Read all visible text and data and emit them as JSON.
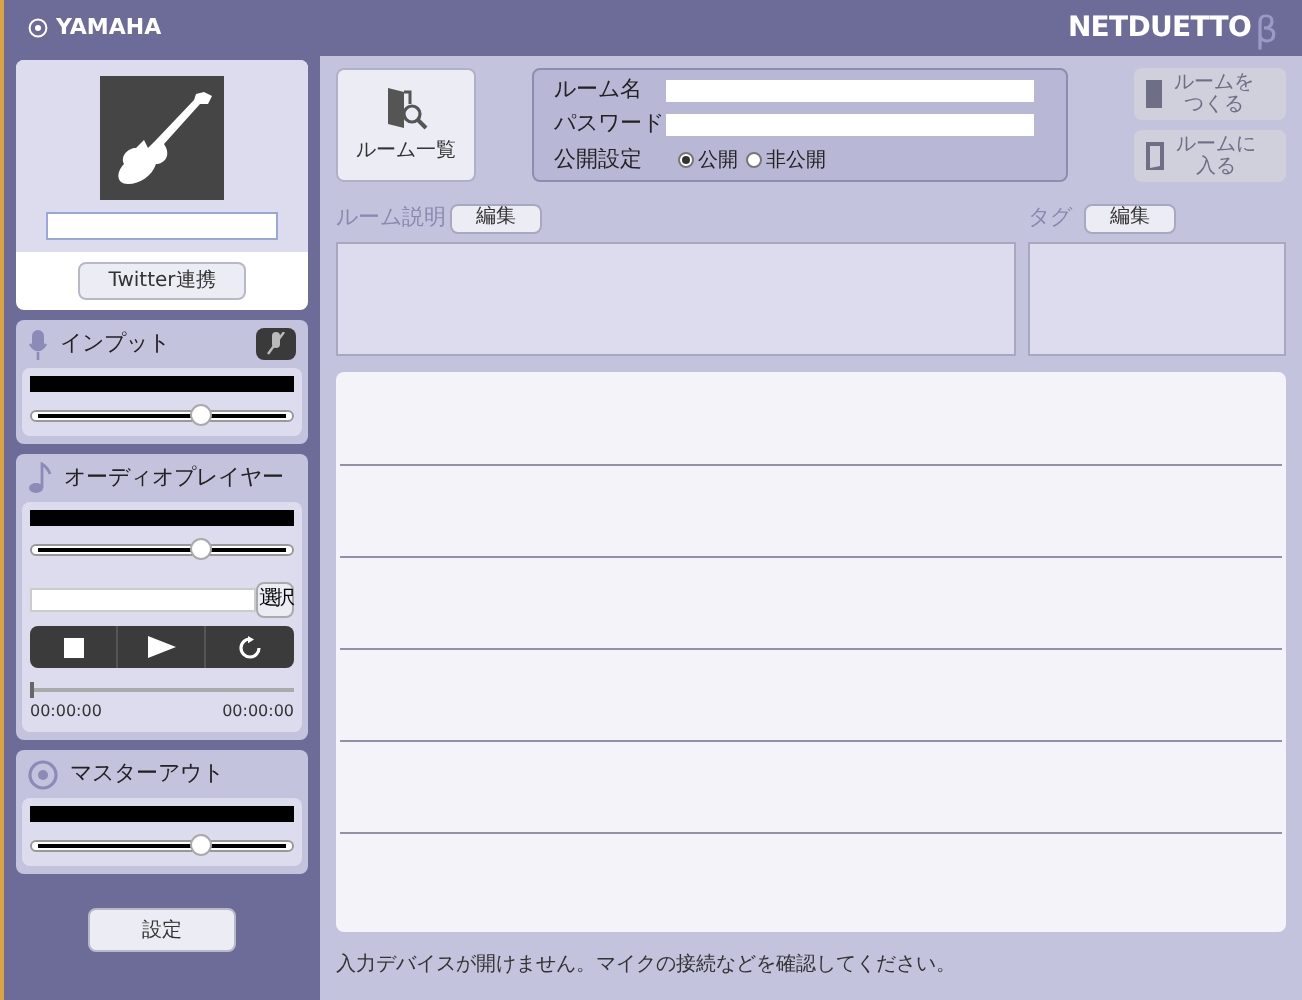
{
  "header": {
    "brand": "YAMAHA",
    "app_logo": "NETDUETTO",
    "app_logo_suffix": "β"
  },
  "profile": {
    "twitter_button": "Twitter連携"
  },
  "input": {
    "title": "インプット",
    "muted": true,
    "volume": {
      "level": 0.65
    }
  },
  "audio_player": {
    "title": "オーディオプレイヤー",
    "volume": {
      "level": 0.65
    },
    "file_button": "選択",
    "progress": {
      "level": 0
    },
    "time_start": "00:00:00",
    "time_end": "00:00:00"
  },
  "master_out": {
    "title": "マスターアウト",
    "volume": {
      "level": 0.65
    }
  },
  "settings_button": "設定",
  "room_list_button": "ルーム一覧",
  "room_form": {
    "name_label": "ルーム名",
    "password_label": "パスワード",
    "visibility_label": "公開設定",
    "visibility_options": [
      {
        "label": "公開",
        "selected": true
      },
      {
        "label": "非公開",
        "selected": false
      }
    ]
  },
  "room_actions": [
    {
      "label": "ルームをつくる",
      "disabled": true,
      "kind": "create"
    },
    {
      "label": "ルームに入る",
      "disabled": true,
      "kind": "enter"
    }
  ],
  "description": {
    "label": "ルーム説明",
    "edit_button": "編集"
  },
  "tags": {
    "label": "タグ",
    "edit_button": "編集"
  },
  "status_message": "入力デバイスが開けません。マイクの接続などを確認してください。"
}
